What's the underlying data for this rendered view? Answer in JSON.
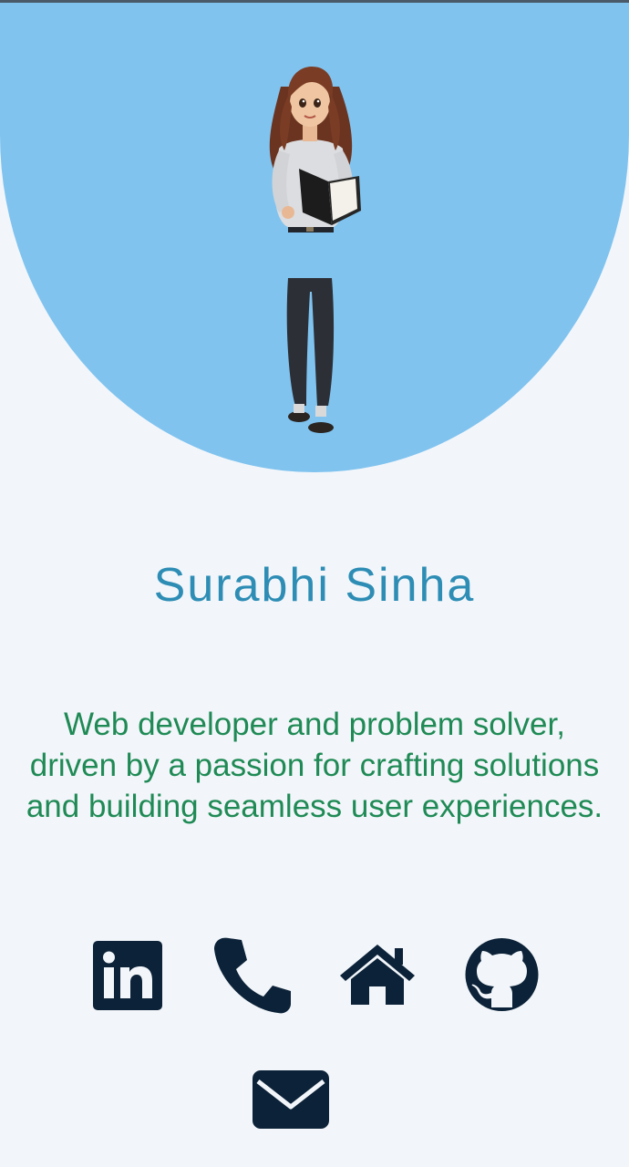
{
  "profile": {
    "name": "Surabhi Sinha",
    "bio_lines": [
      "Web developer and problem solver,",
      "driven by a passion for crafting solutions",
      "and building seamless user experiences."
    ]
  },
  "icons": {
    "linkedin": "linkedin-icon",
    "phone": "phone-icon",
    "home": "home-icon",
    "github": "github-icon",
    "email": "email-icon"
  },
  "colors": {
    "background": "#f2f6fa",
    "hero": "#80c3ef",
    "name": "#2e8db5",
    "bio": "#1f8a55",
    "icon": "#0c2238"
  }
}
